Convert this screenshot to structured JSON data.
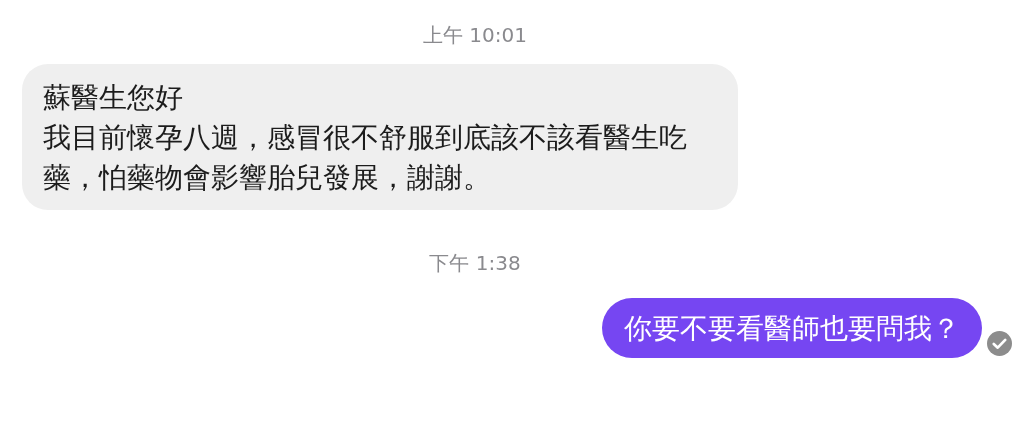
{
  "items": [
    {
      "kind": "timestamp",
      "text": "上午 10:01"
    },
    {
      "kind": "message",
      "outgoing": false,
      "lines": [
        "蘇醫生您好",
        "我目前懷孕八週，感冒很不舒服到底該不該看醫生吃藥，怕藥物會影響胎兒發展，謝謝。"
      ]
    },
    {
      "kind": "timestamp",
      "text": "下午 1:38"
    },
    {
      "kind": "message",
      "outgoing": true,
      "lines": [
        "你要不要看醫師也要問我？"
      ],
      "delivered": true
    }
  ]
}
